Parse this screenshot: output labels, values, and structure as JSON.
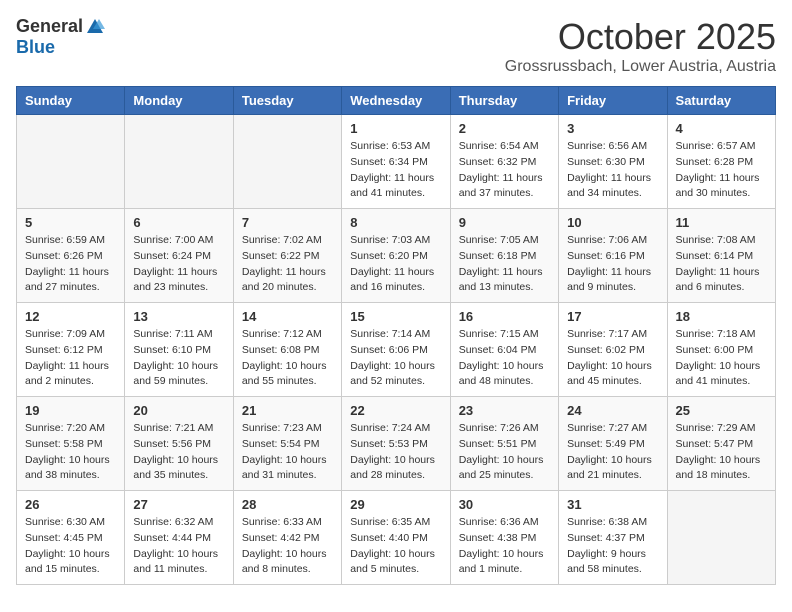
{
  "header": {
    "logo_general": "General",
    "logo_blue": "Blue",
    "month": "October 2025",
    "location": "Grossrussbach, Lower Austria, Austria"
  },
  "weekdays": [
    "Sunday",
    "Monday",
    "Tuesday",
    "Wednesday",
    "Thursday",
    "Friday",
    "Saturday"
  ],
  "weeks": [
    [
      {
        "day": "",
        "info": ""
      },
      {
        "day": "",
        "info": ""
      },
      {
        "day": "",
        "info": ""
      },
      {
        "day": "1",
        "info": "Sunrise: 6:53 AM\nSunset: 6:34 PM\nDaylight: 11 hours\nand 41 minutes."
      },
      {
        "day": "2",
        "info": "Sunrise: 6:54 AM\nSunset: 6:32 PM\nDaylight: 11 hours\nand 37 minutes."
      },
      {
        "day": "3",
        "info": "Sunrise: 6:56 AM\nSunset: 6:30 PM\nDaylight: 11 hours\nand 34 minutes."
      },
      {
        "day": "4",
        "info": "Sunrise: 6:57 AM\nSunset: 6:28 PM\nDaylight: 11 hours\nand 30 minutes."
      }
    ],
    [
      {
        "day": "5",
        "info": "Sunrise: 6:59 AM\nSunset: 6:26 PM\nDaylight: 11 hours\nand 27 minutes."
      },
      {
        "day": "6",
        "info": "Sunrise: 7:00 AM\nSunset: 6:24 PM\nDaylight: 11 hours\nand 23 minutes."
      },
      {
        "day": "7",
        "info": "Sunrise: 7:02 AM\nSunset: 6:22 PM\nDaylight: 11 hours\nand 20 minutes."
      },
      {
        "day": "8",
        "info": "Sunrise: 7:03 AM\nSunset: 6:20 PM\nDaylight: 11 hours\nand 16 minutes."
      },
      {
        "day": "9",
        "info": "Sunrise: 7:05 AM\nSunset: 6:18 PM\nDaylight: 11 hours\nand 13 minutes."
      },
      {
        "day": "10",
        "info": "Sunrise: 7:06 AM\nSunset: 6:16 PM\nDaylight: 11 hours\nand 9 minutes."
      },
      {
        "day": "11",
        "info": "Sunrise: 7:08 AM\nSunset: 6:14 PM\nDaylight: 11 hours\nand 6 minutes."
      }
    ],
    [
      {
        "day": "12",
        "info": "Sunrise: 7:09 AM\nSunset: 6:12 PM\nDaylight: 11 hours\nand 2 minutes."
      },
      {
        "day": "13",
        "info": "Sunrise: 7:11 AM\nSunset: 6:10 PM\nDaylight: 10 hours\nand 59 minutes."
      },
      {
        "day": "14",
        "info": "Sunrise: 7:12 AM\nSunset: 6:08 PM\nDaylight: 10 hours\nand 55 minutes."
      },
      {
        "day": "15",
        "info": "Sunrise: 7:14 AM\nSunset: 6:06 PM\nDaylight: 10 hours\nand 52 minutes."
      },
      {
        "day": "16",
        "info": "Sunrise: 7:15 AM\nSunset: 6:04 PM\nDaylight: 10 hours\nand 48 minutes."
      },
      {
        "day": "17",
        "info": "Sunrise: 7:17 AM\nSunset: 6:02 PM\nDaylight: 10 hours\nand 45 minutes."
      },
      {
        "day": "18",
        "info": "Sunrise: 7:18 AM\nSunset: 6:00 PM\nDaylight: 10 hours\nand 41 minutes."
      }
    ],
    [
      {
        "day": "19",
        "info": "Sunrise: 7:20 AM\nSunset: 5:58 PM\nDaylight: 10 hours\nand 38 minutes."
      },
      {
        "day": "20",
        "info": "Sunrise: 7:21 AM\nSunset: 5:56 PM\nDaylight: 10 hours\nand 35 minutes."
      },
      {
        "day": "21",
        "info": "Sunrise: 7:23 AM\nSunset: 5:54 PM\nDaylight: 10 hours\nand 31 minutes."
      },
      {
        "day": "22",
        "info": "Sunrise: 7:24 AM\nSunset: 5:53 PM\nDaylight: 10 hours\nand 28 minutes."
      },
      {
        "day": "23",
        "info": "Sunrise: 7:26 AM\nSunset: 5:51 PM\nDaylight: 10 hours\nand 25 minutes."
      },
      {
        "day": "24",
        "info": "Sunrise: 7:27 AM\nSunset: 5:49 PM\nDaylight: 10 hours\nand 21 minutes."
      },
      {
        "day": "25",
        "info": "Sunrise: 7:29 AM\nSunset: 5:47 PM\nDaylight: 10 hours\nand 18 minutes."
      }
    ],
    [
      {
        "day": "26",
        "info": "Sunrise: 6:30 AM\nSunset: 4:45 PM\nDaylight: 10 hours\nand 15 minutes."
      },
      {
        "day": "27",
        "info": "Sunrise: 6:32 AM\nSunset: 4:44 PM\nDaylight: 10 hours\nand 11 minutes."
      },
      {
        "day": "28",
        "info": "Sunrise: 6:33 AM\nSunset: 4:42 PM\nDaylight: 10 hours\nand 8 minutes."
      },
      {
        "day": "29",
        "info": "Sunrise: 6:35 AM\nSunset: 4:40 PM\nDaylight: 10 hours\nand 5 minutes."
      },
      {
        "day": "30",
        "info": "Sunrise: 6:36 AM\nSunset: 4:38 PM\nDaylight: 10 hours\nand 1 minute."
      },
      {
        "day": "31",
        "info": "Sunrise: 6:38 AM\nSunset: 4:37 PM\nDaylight: 9 hours\nand 58 minutes."
      },
      {
        "day": "",
        "info": ""
      }
    ]
  ]
}
